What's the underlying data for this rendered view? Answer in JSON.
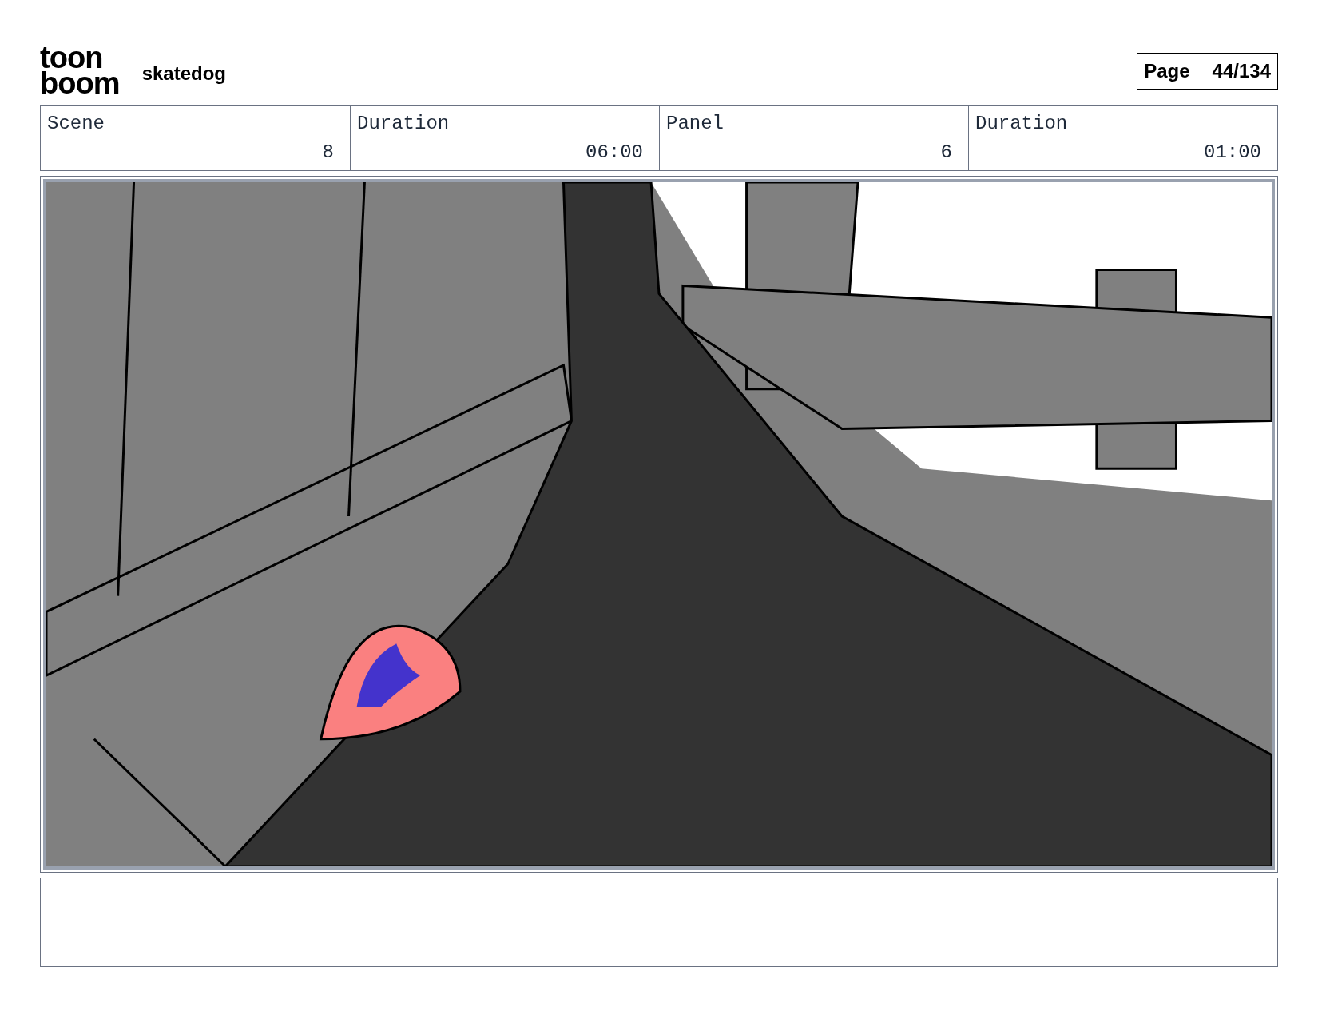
{
  "logo": {
    "line_1": "toon",
    "line_2": "boom"
  },
  "project": "skatedog",
  "page": {
    "label": "Page",
    "value": "44/134"
  },
  "fields": [
    {
      "label": "Scene",
      "value": "8"
    },
    {
      "label": "Duration",
      "value": "06:00"
    },
    {
      "label": "Panel",
      "value": "6"
    },
    {
      "label": "Duration",
      "value": "01:00"
    }
  ]
}
